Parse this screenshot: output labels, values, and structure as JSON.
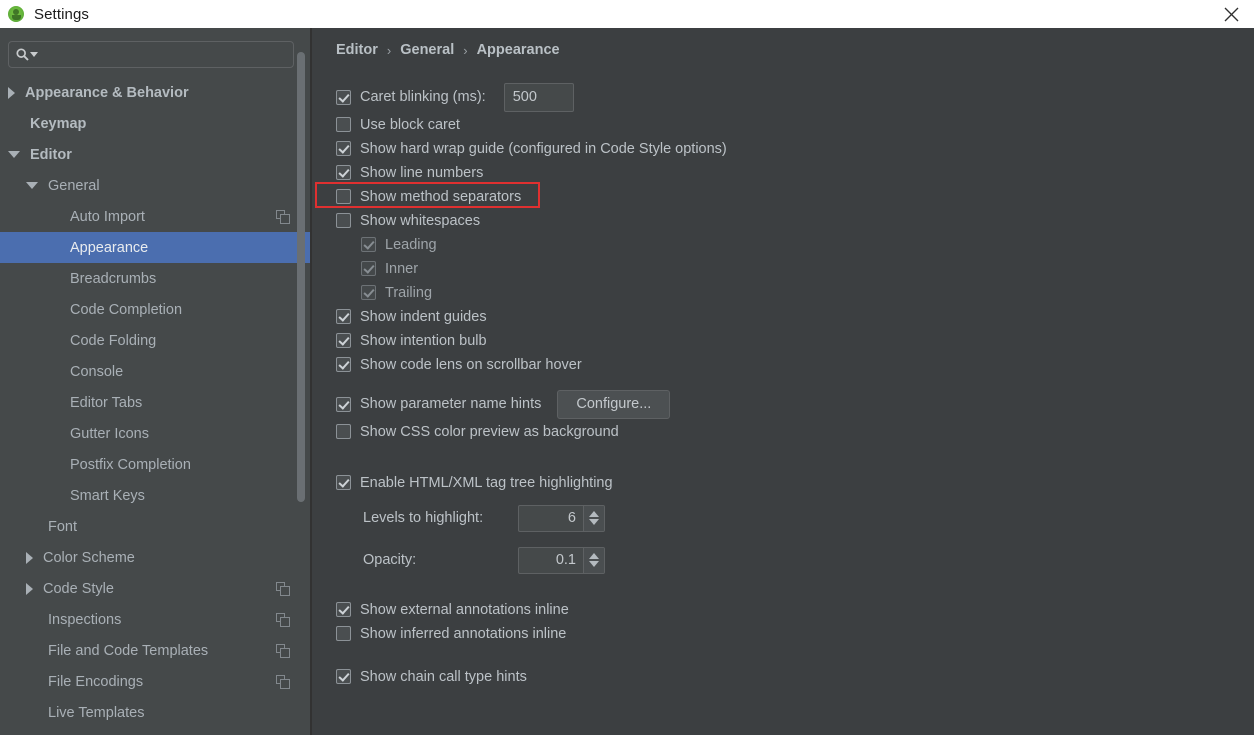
{
  "window": {
    "title": "Settings",
    "app_icon": "android-studio-icon",
    "close_label": "×"
  },
  "sidebar": {
    "search": {
      "placeholder": "",
      "value": "",
      "icon": "search-icon"
    },
    "items": [
      {
        "label": "Appearance & Behavior",
        "level": 0,
        "twisty": "right",
        "bold": true,
        "selected": false,
        "copy_icon": false
      },
      {
        "label": "Keymap",
        "level": 0,
        "twisty": "none",
        "bold": true,
        "selected": false,
        "copy_icon": false
      },
      {
        "label": "Editor",
        "level": 0,
        "twisty": "down",
        "bold": true,
        "selected": false,
        "copy_icon": false
      },
      {
        "label": "General",
        "level": 1,
        "twisty": "down",
        "bold": false,
        "selected": false,
        "copy_icon": false
      },
      {
        "label": "Auto Import",
        "level": 2,
        "twisty": "none",
        "bold": false,
        "selected": false,
        "copy_icon": true
      },
      {
        "label": "Appearance",
        "level": 2,
        "twisty": "none",
        "bold": false,
        "selected": true,
        "copy_icon": false
      },
      {
        "label": "Breadcrumbs",
        "level": 2,
        "twisty": "none",
        "bold": false,
        "selected": false,
        "copy_icon": false
      },
      {
        "label": "Code Completion",
        "level": 2,
        "twisty": "none",
        "bold": false,
        "selected": false,
        "copy_icon": false
      },
      {
        "label": "Code Folding",
        "level": 2,
        "twisty": "none",
        "bold": false,
        "selected": false,
        "copy_icon": false
      },
      {
        "label": "Console",
        "level": 2,
        "twisty": "none",
        "bold": false,
        "selected": false,
        "copy_icon": false
      },
      {
        "label": "Editor Tabs",
        "level": 2,
        "twisty": "none",
        "bold": false,
        "selected": false,
        "copy_icon": false
      },
      {
        "label": "Gutter Icons",
        "level": 2,
        "twisty": "none",
        "bold": false,
        "selected": false,
        "copy_icon": false
      },
      {
        "label": "Postfix Completion",
        "level": 2,
        "twisty": "none",
        "bold": false,
        "selected": false,
        "copy_icon": false
      },
      {
        "label": "Smart Keys",
        "level": 2,
        "twisty": "none",
        "bold": false,
        "selected": false,
        "copy_icon": false
      },
      {
        "label": "Font",
        "level": 1,
        "twisty": "none",
        "bold": false,
        "selected": false,
        "copy_icon": false
      },
      {
        "label": "Color Scheme",
        "level": 1,
        "twisty": "right",
        "bold": false,
        "selected": false,
        "copy_icon": false
      },
      {
        "label": "Code Style",
        "level": 1,
        "twisty": "right",
        "bold": false,
        "selected": false,
        "copy_icon": true
      },
      {
        "label": "Inspections",
        "level": 1,
        "twisty": "none",
        "bold": false,
        "selected": false,
        "copy_icon": true
      },
      {
        "label": "File and Code Templates",
        "level": 1,
        "twisty": "none",
        "bold": false,
        "selected": false,
        "copy_icon": true
      },
      {
        "label": "File Encodings",
        "level": 1,
        "twisty": "none",
        "bold": false,
        "selected": false,
        "copy_icon": true
      },
      {
        "label": "Live Templates",
        "level": 1,
        "twisty": "none",
        "bold": false,
        "selected": false,
        "copy_icon": false
      }
    ]
  },
  "content": {
    "breadcrumb": [
      "Editor",
      "General",
      "Appearance"
    ],
    "breadcrumb_separator": "›",
    "caret_blinking": {
      "label": "Caret blinking (ms):",
      "checked": true,
      "value": "500"
    },
    "options": [
      {
        "label": "Use block caret",
        "checked": false,
        "disabled": false,
        "indent": 0
      },
      {
        "label": "Show hard wrap guide (configured in Code Style options)",
        "checked": true,
        "disabled": false,
        "indent": 0
      },
      {
        "label": "Show line numbers",
        "checked": true,
        "disabled": false,
        "indent": 0,
        "highlighted": true
      },
      {
        "label": "Show method separators",
        "checked": false,
        "disabled": false,
        "indent": 0
      },
      {
        "label": "Show whitespaces",
        "checked": false,
        "disabled": false,
        "indent": 0
      },
      {
        "label": "Leading",
        "checked": true,
        "disabled": true,
        "indent": 1
      },
      {
        "label": "Inner",
        "checked": true,
        "disabled": true,
        "indent": 1
      },
      {
        "label": "Trailing",
        "checked": true,
        "disabled": true,
        "indent": 1
      },
      {
        "label": "Show indent guides",
        "checked": true,
        "disabled": false,
        "indent": 0
      },
      {
        "label": "Show intention bulb",
        "checked": true,
        "disabled": false,
        "indent": 0
      },
      {
        "label": "Show code lens on scrollbar hover",
        "checked": true,
        "disabled": false,
        "indent": 0
      }
    ],
    "parameter_hints": {
      "label": "Show parameter name hints",
      "checked": true,
      "button": "Configure..."
    },
    "css_color_preview": {
      "label": "Show CSS color preview as background",
      "checked": false
    },
    "tag_tree": {
      "label": "Enable HTML/XML tag tree highlighting",
      "checked": true,
      "levels_label": "Levels to highlight:",
      "levels_value": "6",
      "opacity_label": "Opacity:",
      "opacity_value": "0.1"
    },
    "annotations": [
      {
        "label": "Show external annotations inline",
        "checked": true
      },
      {
        "label": "Show inferred annotations inline",
        "checked": false
      }
    ],
    "chain_hints": {
      "label": "Show chain call type hints",
      "checked": true
    }
  },
  "colors": {
    "titlebar_bg": "#ffffff",
    "sidebar_bg": "#45494a",
    "content_bg": "#3c3f41",
    "selection_blue": "#4b6eaf",
    "highlight_red": "#e03030",
    "text": "#bcc2c7"
  }
}
